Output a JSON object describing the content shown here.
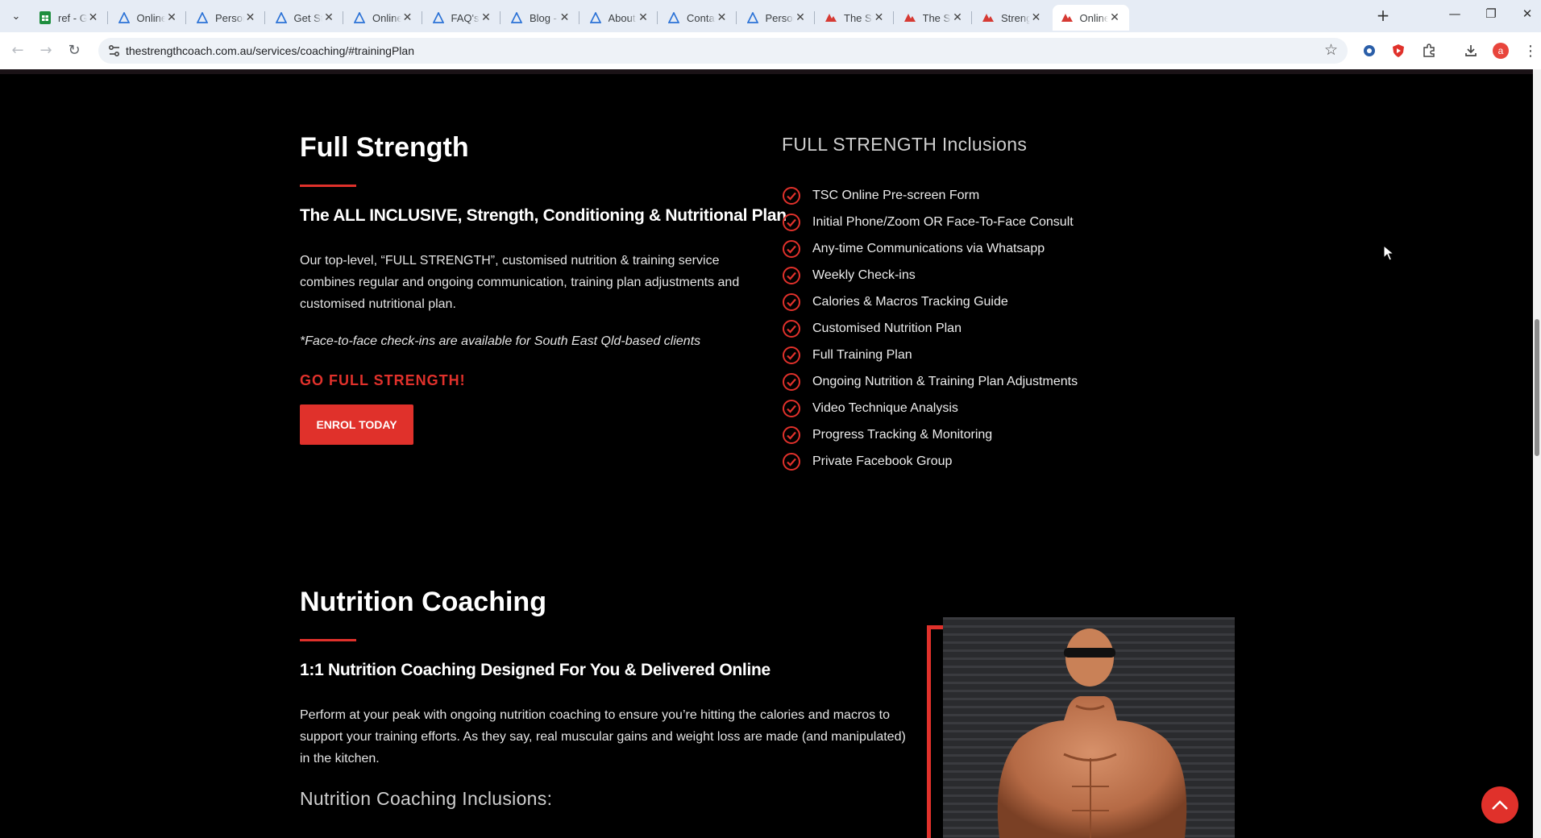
{
  "browser": {
    "tabs": [
      {
        "title": "ref - Google Sheets",
        "icon": "sheets-icon"
      },
      {
        "title": "Online Personal Training",
        "icon": "triangle-icon"
      },
      {
        "title": "Personal Training",
        "icon": "triangle-icon"
      },
      {
        "title": "Get Started",
        "icon": "triangle-icon"
      },
      {
        "title": "Online Personal Training",
        "icon": "triangle-icon"
      },
      {
        "title": "FAQ's - The Strength Coach",
        "icon": "triangle-icon"
      },
      {
        "title": "Blog - The Strength Coach",
        "icon": "triangle-icon"
      },
      {
        "title": "About - The Strength Coach",
        "icon": "triangle-icon"
      },
      {
        "title": "Contact",
        "icon": "triangle-icon"
      },
      {
        "title": "Personal Training",
        "icon": "triangle-icon"
      },
      {
        "title": "The Strength Coach",
        "icon": "tsc-icon"
      },
      {
        "title": "The Strength Coach",
        "icon": "tsc-icon"
      },
      {
        "title": "Strength Coaching",
        "icon": "tsc-icon"
      },
      {
        "title": "Online - Coaching",
        "icon": "tsc-icon"
      }
    ],
    "active_tab": 13,
    "url": "thestrengthcoach.com.au/services/coaching/#trainingPlan",
    "profile_initial": "a"
  },
  "full_strength": {
    "title": "Full Strength",
    "subtitle": "The ALL INCLUSIVE, Strength, Conditioning & Nutritional Plan",
    "description": "Our top-level, “FULL STRENGTH”, customised nutrition & training service combines regular and ongoing communication, training plan adjustments and customised nutritional plan.",
    "note": "*Face-to-face check-ins are available for South East Qld-based clients",
    "cta_text": "GO FULL STRENGTH!",
    "button_label": "ENROL TODAY",
    "inclusions_title": "FULL STRENGTH Inclusions",
    "inclusions": [
      "TSC Online Pre-screen Form",
      "Initial Phone/Zoom OR Face-To-Face Consult",
      "Any-time Communications via Whatsapp",
      "Weekly Check-ins",
      "Calories & Macros Tracking Guide",
      "Customised Nutrition Plan",
      "Full Training Plan",
      "Ongoing Nutrition & Training Plan Adjustments",
      "Video Technique Analysis",
      "Progress Tracking & Monitoring",
      "Private Facebook Group"
    ]
  },
  "nutrition": {
    "title": "Nutrition Coaching",
    "subtitle": "1:1 Nutrition Coaching Designed For You & Delivered Online",
    "description": "Perform at your peak with ongoing nutrition coaching to ensure you’re hitting the calories and macros to support your training efforts. As they say, real muscular gains and weight loss are made (and manipulated) in the kitchen.",
    "inclusions_title": "Nutrition Coaching Inclusions:"
  },
  "colors": {
    "accent": "#e0312b",
    "background": "#000000"
  }
}
